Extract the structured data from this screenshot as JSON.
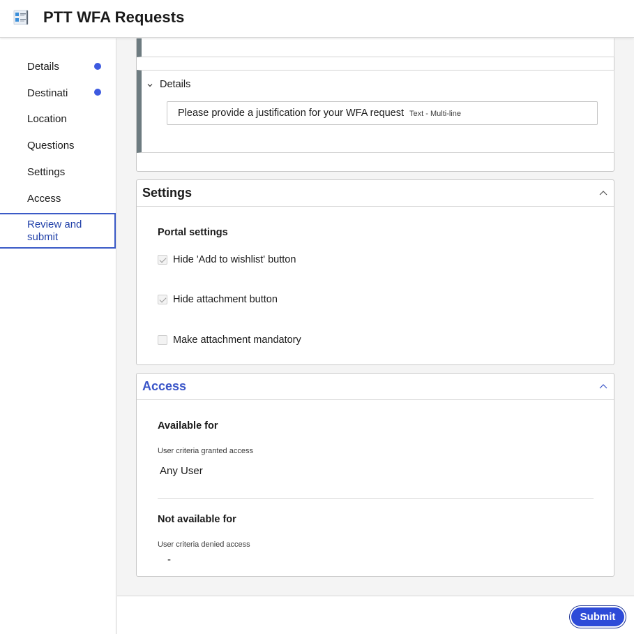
{
  "header": {
    "title": "PTT WFA Requests",
    "icon": "form-list-icon"
  },
  "sidebar": {
    "items": [
      {
        "label": "Details",
        "has_dot": true
      },
      {
        "label": "Destinati",
        "has_dot": true
      },
      {
        "label": "Location",
        "has_dot": false
      },
      {
        "label": "Questions",
        "has_dot": false
      },
      {
        "label": "Settings",
        "has_dot": false
      },
      {
        "label": "Access",
        "has_dot": false
      },
      {
        "label": "Review and submit",
        "has_dot": false,
        "active": true
      }
    ],
    "dot_color": "#3d5ae0"
  },
  "variable_block": {
    "toggle_label": "Details",
    "input_text": "Please provide a justification for your WFA request",
    "input_type": "Text - Multi-line"
  },
  "settings": {
    "title": "Settings",
    "subtitle": "Portal settings",
    "options": [
      {
        "label": "Hide 'Add to wishlist' button",
        "checked": true
      },
      {
        "label": "Hide attachment button",
        "checked": true
      },
      {
        "label": "Make attachment mandatory",
        "checked": false
      }
    ]
  },
  "access": {
    "title": "Access",
    "title_color": "#3a55c8",
    "available_heading": "Available for",
    "granted_label": "User criteria granted access",
    "granted_value": "Any User",
    "not_available_heading": "Not available for",
    "denied_label": "User criteria denied access",
    "denied_value": "-"
  },
  "footer": {
    "submit_label": "Submit",
    "accent": "#2d4bd8"
  }
}
